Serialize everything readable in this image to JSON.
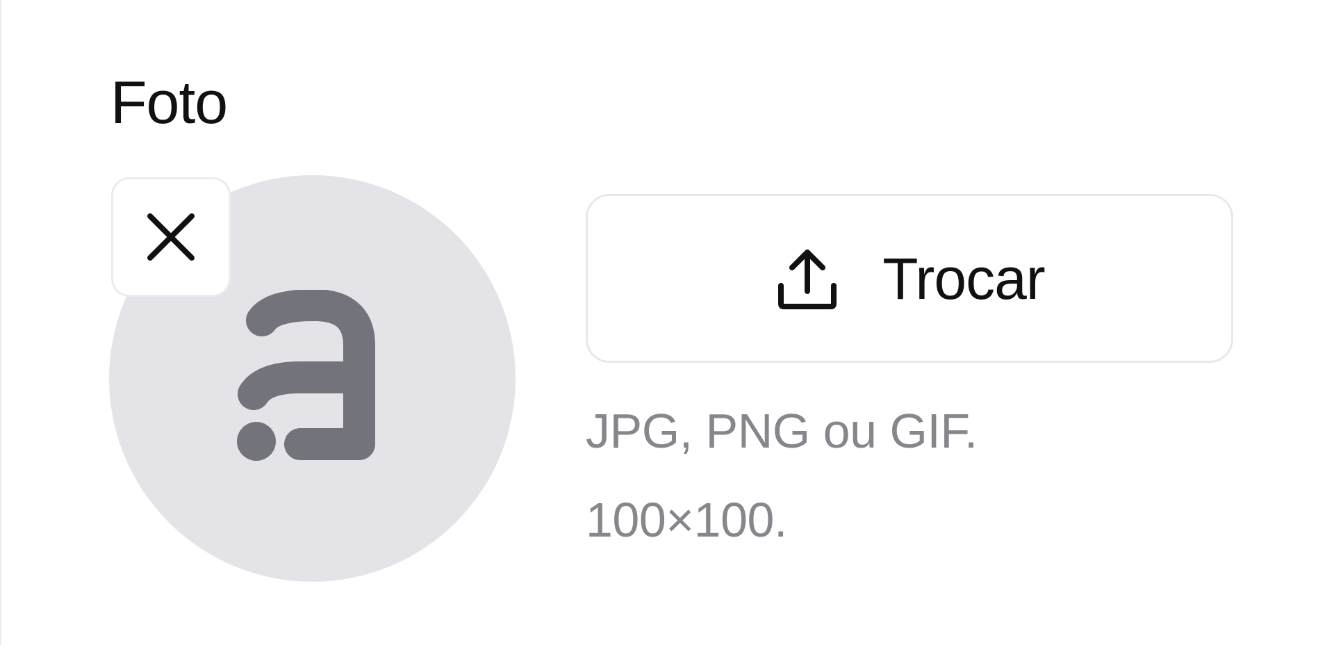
{
  "photo": {
    "label": "Foto",
    "avatar_icon": "brand-a-glyph-icon",
    "remove_icon": "close-icon",
    "change_button": {
      "label": "Trocar",
      "icon": "upload-icon"
    },
    "hint_formats": "JPG, PNG ou GIF.",
    "hint_size": "100×100."
  },
  "colors": {
    "avatar_bg": "#e4e4e8",
    "avatar_glyph": "#73737b",
    "hint_text": "#86868c",
    "border": "#e8e8ec"
  }
}
